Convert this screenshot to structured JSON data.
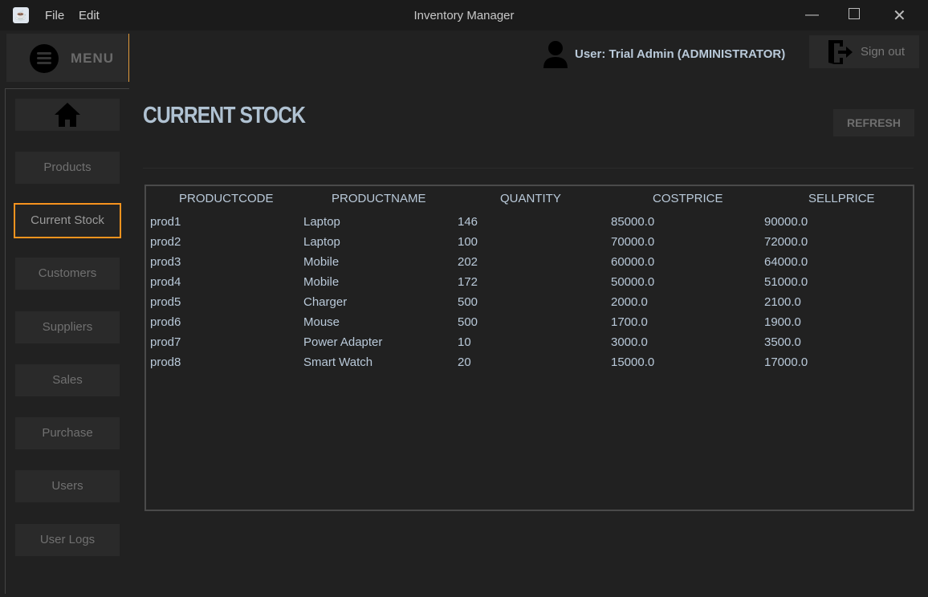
{
  "window": {
    "title": "Inventory Manager",
    "menus": [
      "File",
      "Edit"
    ]
  },
  "sidebar": {
    "menu_label": "MENU",
    "items": [
      "Products",
      "Current Stock",
      "Customers",
      "Suppliers",
      "Sales",
      "Purchase",
      "Users",
      "User Logs"
    ],
    "active": "Current Stock"
  },
  "header": {
    "user": "User: Trial Admin (ADMINISTRATOR)",
    "sign_out": "Sign out"
  },
  "main": {
    "title": "CURRENT STOCK",
    "refresh": "REFRESH"
  },
  "table": {
    "columns": [
      "PRODUCTCODE",
      "PRODUCTNAME",
      "QUANTITY",
      "COSTPRICE",
      "SELLPRICE"
    ],
    "rows": [
      [
        "prod1",
        "Laptop",
        "146",
        "85000.0",
        "90000.0"
      ],
      [
        "prod2",
        "Laptop",
        "100",
        "70000.0",
        "72000.0"
      ],
      [
        "prod3",
        "Mobile",
        "202",
        "60000.0",
        "64000.0"
      ],
      [
        "prod4",
        "Mobile",
        "172",
        "50000.0",
        "51000.0"
      ],
      [
        "prod5",
        "Charger",
        "500",
        "2000.0",
        "2100.0"
      ],
      [
        "prod6",
        "Mouse",
        "500",
        "1700.0",
        "1900.0"
      ],
      [
        "prod7",
        "Power Adapter",
        "10",
        "3000.0",
        "3500.0"
      ],
      [
        "prod8",
        "Smart Watch",
        "20",
        "15000.0",
        "17000.0"
      ]
    ]
  },
  "colors": {
    "accent": "#f7931e",
    "background": "#212121",
    "text": "#b9c9d9"
  }
}
